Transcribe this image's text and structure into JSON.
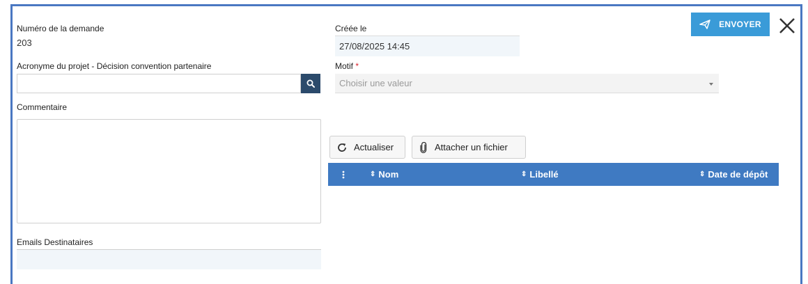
{
  "form": {
    "request_number_label": "Numéro de la demande",
    "request_number_value": "203",
    "created_label": "Créée le",
    "created_value": "27/08/2025 14:45",
    "acronym_label": "Acronyme du projet - Décision convention partenaire",
    "acronym_value": "",
    "motif_label": "Motif",
    "motif_required_mark": "*",
    "motif_placeholder": "Choisir une valeur",
    "comment_label": "Commentaire",
    "comment_value": "",
    "emails_label": "Emails Destinataires",
    "emails_value": ""
  },
  "actions": {
    "send_label": "ENVOYER",
    "close_icon": "close-icon",
    "send_icon": "paper-plane-icon",
    "search_icon": "search-icon"
  },
  "attachments": {
    "refresh_label": "Actualiser",
    "attach_label": "Attacher un fichier",
    "columns": [
      "Nom",
      "Libellé",
      "Date de dépôt"
    ]
  },
  "colors": {
    "accent_blue": "#3a9bd8",
    "table_header": "#3f7ac2",
    "search_button": "#2b4a6b",
    "frame_border": "#4a78c2",
    "required": "#d9232e"
  }
}
